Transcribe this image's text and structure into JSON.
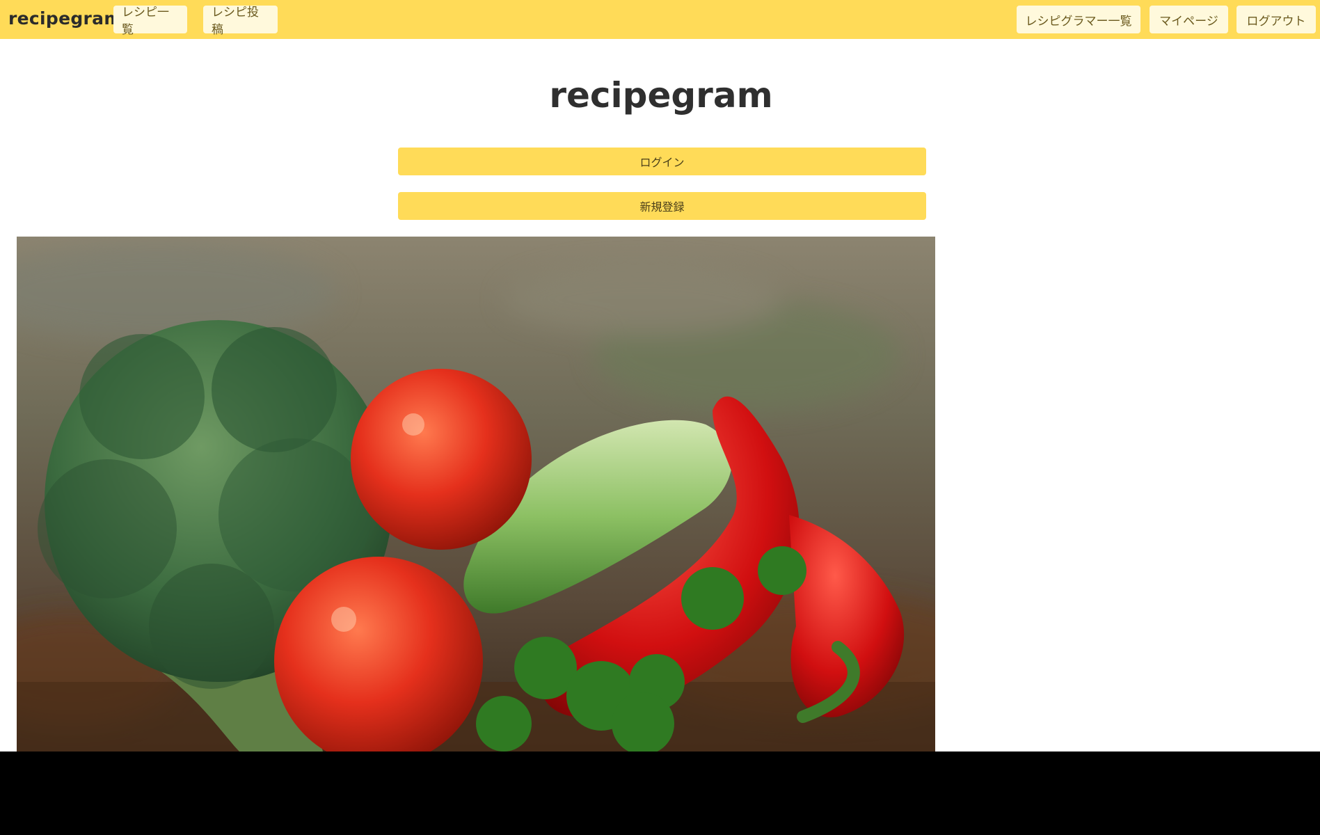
{
  "navbar": {
    "brand": "recipegram",
    "left_links": [
      "レシピ一覧",
      "レシピ投稿"
    ],
    "right_links": [
      "レシピグラマー一覧",
      "マイページ",
      "ログアウト"
    ]
  },
  "main": {
    "title": "recipegram",
    "login_label": "ログイン",
    "signup_label": "新規登録"
  },
  "hero_image": {
    "subject": "vegetables: broccoli, tomatoes, cucumber, red peppers, parsley"
  },
  "colors": {
    "accent": "#ffdb58",
    "nav_button_bg": "#fff9dc",
    "text_dark": "#2f2f2f"
  }
}
